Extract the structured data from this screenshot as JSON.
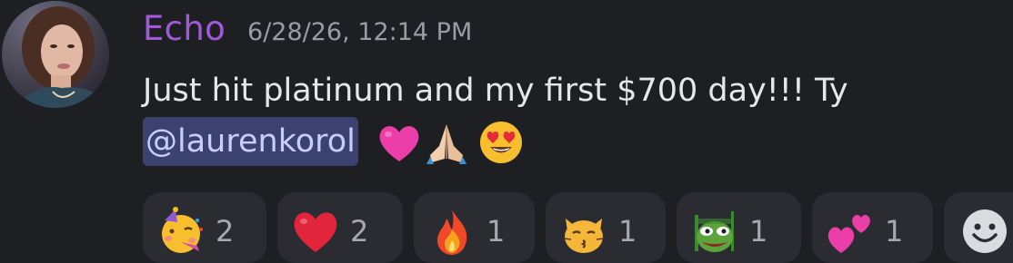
{
  "message": {
    "author": "Echo",
    "timestamp": "6/28/26, 12:14 PM",
    "text_before_mention": "Just hit platinum and my first $700 day!!! Ty ",
    "mention": "@laurenkorol",
    "inline_emojis": [
      "pink-heart",
      "folded-hands",
      "heart-eyes-face"
    ]
  },
  "reactions": [
    {
      "emoji": "partying-face",
      "count": "2"
    },
    {
      "emoji": "red-heart",
      "count": "2"
    },
    {
      "emoji": "fire",
      "count": "1"
    },
    {
      "emoji": "kissing-cat",
      "count": "1"
    },
    {
      "emoji": "custom-pepe",
      "count": "1"
    },
    {
      "emoji": "two-hearts",
      "count": "1"
    }
  ],
  "add_reaction_icon": "smiley-face-icon",
  "colors": {
    "background": "#1e1f23",
    "username": "#a259d9",
    "timestamp": "#9a9ca3",
    "mention_bg": "#3c4270",
    "mention_text": "#c9cdfb",
    "reaction_bg": "#2b2c32"
  }
}
